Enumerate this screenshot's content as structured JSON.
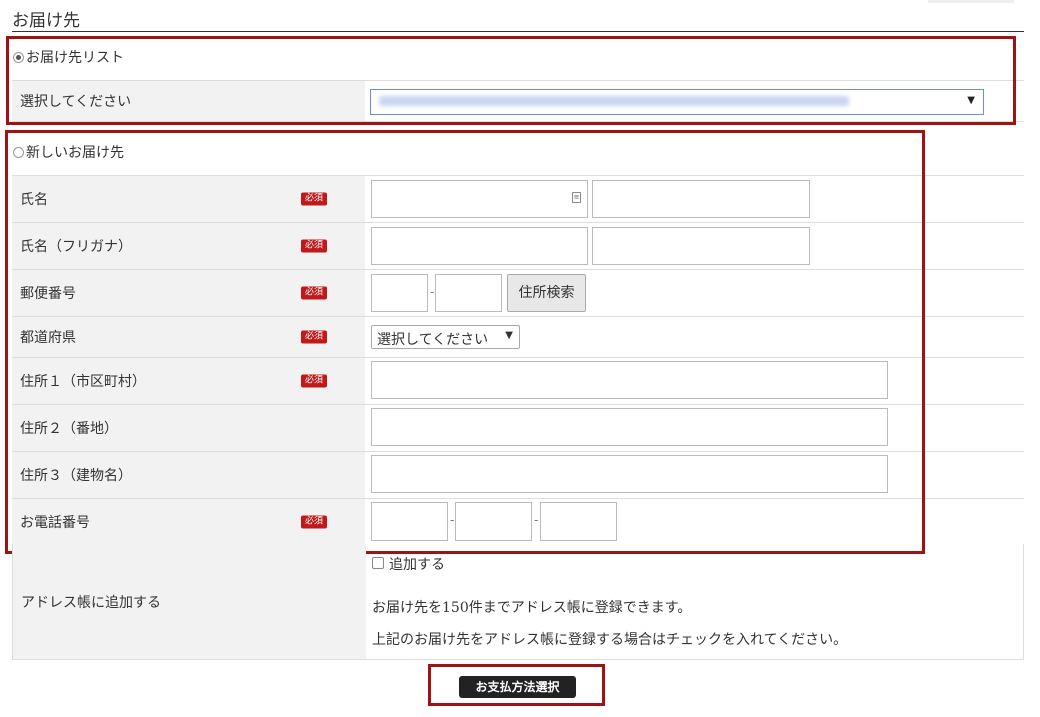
{
  "page": {
    "title": "お届け先"
  },
  "address_list": {
    "radio_label": "お届け先リスト",
    "selected": true,
    "select_label": "選択してください",
    "select_value": ""
  },
  "new_address": {
    "radio_label": "新しいお届け先",
    "selected": false,
    "required_badge": "必須",
    "fields": {
      "name": "氏名",
      "name_kana": "氏名（フリガナ）",
      "postal": "郵便番号",
      "postal_button": "住所検索",
      "prefecture": "都道府県",
      "prefecture_select": "選択してください",
      "address1": "住所１（市区町村）",
      "address2": "住所２（番地）",
      "address3": "住所３（建物名）",
      "phone": "お電話番号"
    }
  },
  "address_book": {
    "label": "アドレス帳に追加する",
    "checkbox_label": "追加する",
    "checked": false,
    "note1": "お届け先を150件までアドレス帳に登録できます。",
    "note2": "上記のお届け先をアドレス帳に登録する場合はチェックを入れてください。"
  },
  "submit": {
    "label": "お支払方法選択"
  },
  "colors": {
    "highlight_border": "#a01313",
    "required_badge": "#c0181b",
    "label_bg": "#f2f2f2"
  }
}
